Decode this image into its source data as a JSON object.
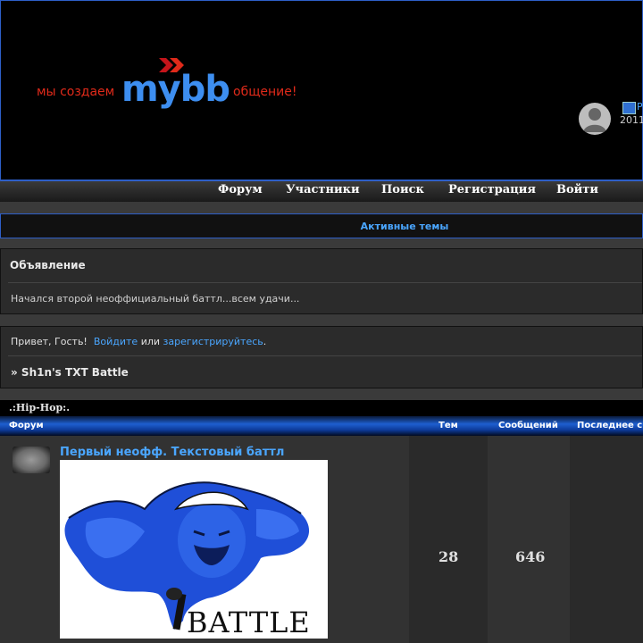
{
  "header": {
    "slogan_left": "мы создаем",
    "brand": "mybb",
    "slogan_right": "общение!"
  },
  "nav": {
    "items": [
      "Форум",
      "Участники",
      "Поиск",
      "Регистрация",
      "Войти"
    ]
  },
  "active_topics": "Активные темы",
  "announcement": {
    "title": "Объявление",
    "text": "Начался второй неофф​ициальный баттл...всем удачи..."
  },
  "welcome": {
    "greeting": "Привет, Гость!",
    "login": "Войдите",
    "or": "или",
    "register": "зарегистрируйтесь",
    "period": ".",
    "crumb": "» Sh1n's TXT Battle"
  },
  "category": {
    "title": ".:Hip-Hop:.",
    "columns": [
      "Форум",
      "Тем",
      "Сообщений",
      "Последнее с"
    ]
  },
  "forum": {
    "title": "Первый неофф. Текстовый баттл",
    "image_word": "BATTLE",
    "topics": "28",
    "posts": "646",
    "last_link": "P",
    "last_date": "2011"
  },
  "colors": {
    "accent": "#2e5fc8",
    "link": "#4aa6ff",
    "logo_red": "#e02a1a",
    "logo_blue": "#3d8ef0"
  }
}
